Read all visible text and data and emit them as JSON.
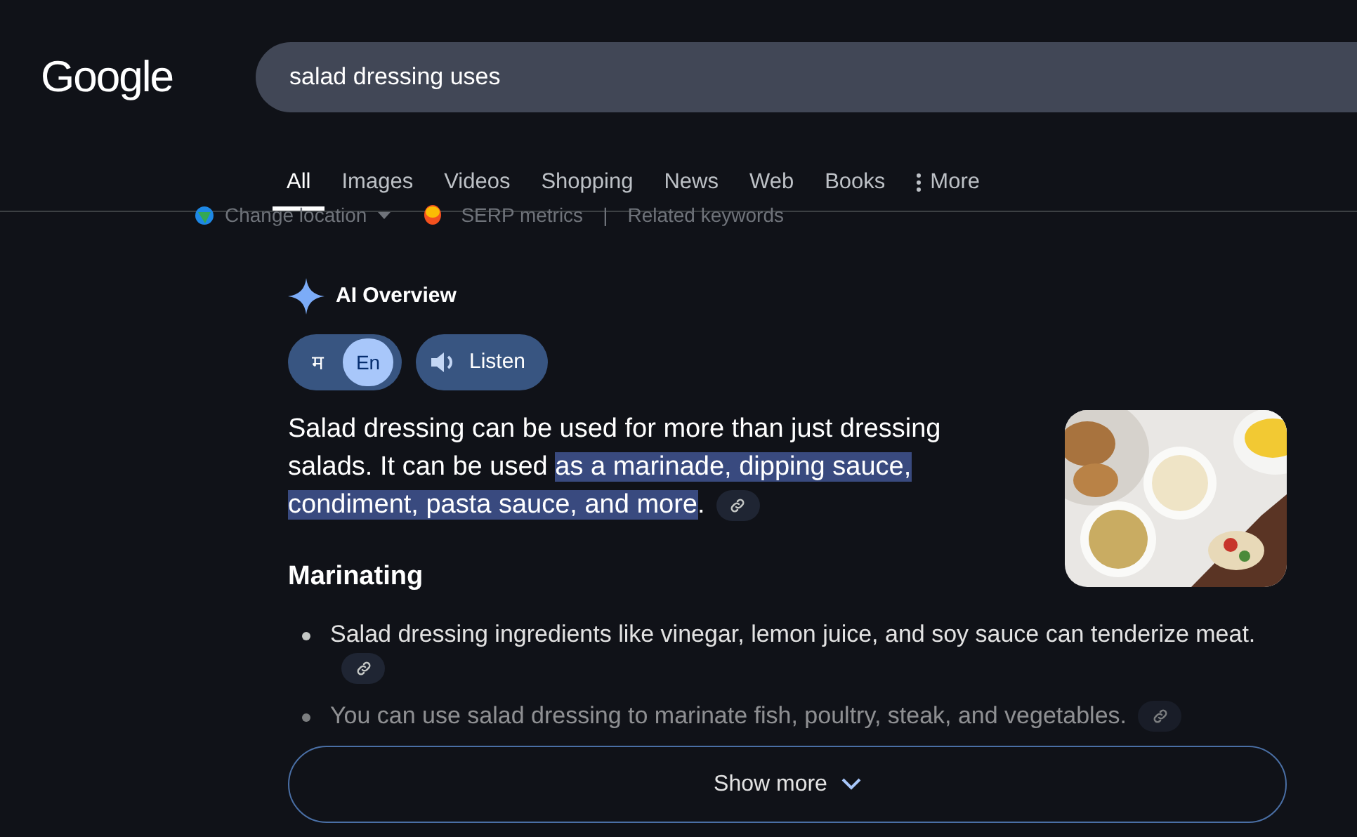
{
  "logo": "Google",
  "search": {
    "value": "salad dressing uses"
  },
  "tabs": [
    {
      "label": "All",
      "selected": true
    },
    {
      "label": "Images",
      "selected": false
    },
    {
      "label": "Videos",
      "selected": false
    },
    {
      "label": "Shopping",
      "selected": false
    },
    {
      "label": "News",
      "selected": false
    },
    {
      "label": "Web",
      "selected": false
    },
    {
      "label": "Books",
      "selected": false
    },
    {
      "label": "More",
      "selected": false,
      "kind": "menu"
    }
  ],
  "extension_bar": {
    "location": "Change location",
    "metrics": "SERP metrics",
    "separator": "|",
    "keywords": "Related keywords"
  },
  "overview": {
    "title": "AI Overview",
    "languages": [
      {
        "label": "म",
        "selected": false
      },
      {
        "label": "En",
        "selected": true
      }
    ],
    "listen": "Listen",
    "intro": {
      "lead": "Salad dressing can be used for more than just dressing salads. It can be used ",
      "highlight": "as a marinade, dipping sauce, condiment, pasta sauce, and more",
      "tail": "."
    },
    "section": "Marinating",
    "bullets": [
      {
        "text": "Salad dressing ingredients like vinegar, lemon juice, and soy sauce can tenderize meat."
      },
      {
        "text": "You can use salad dressing to marinate fish, poultry, steak, and vegetables."
      }
    ],
    "show_more": "Show more"
  }
}
